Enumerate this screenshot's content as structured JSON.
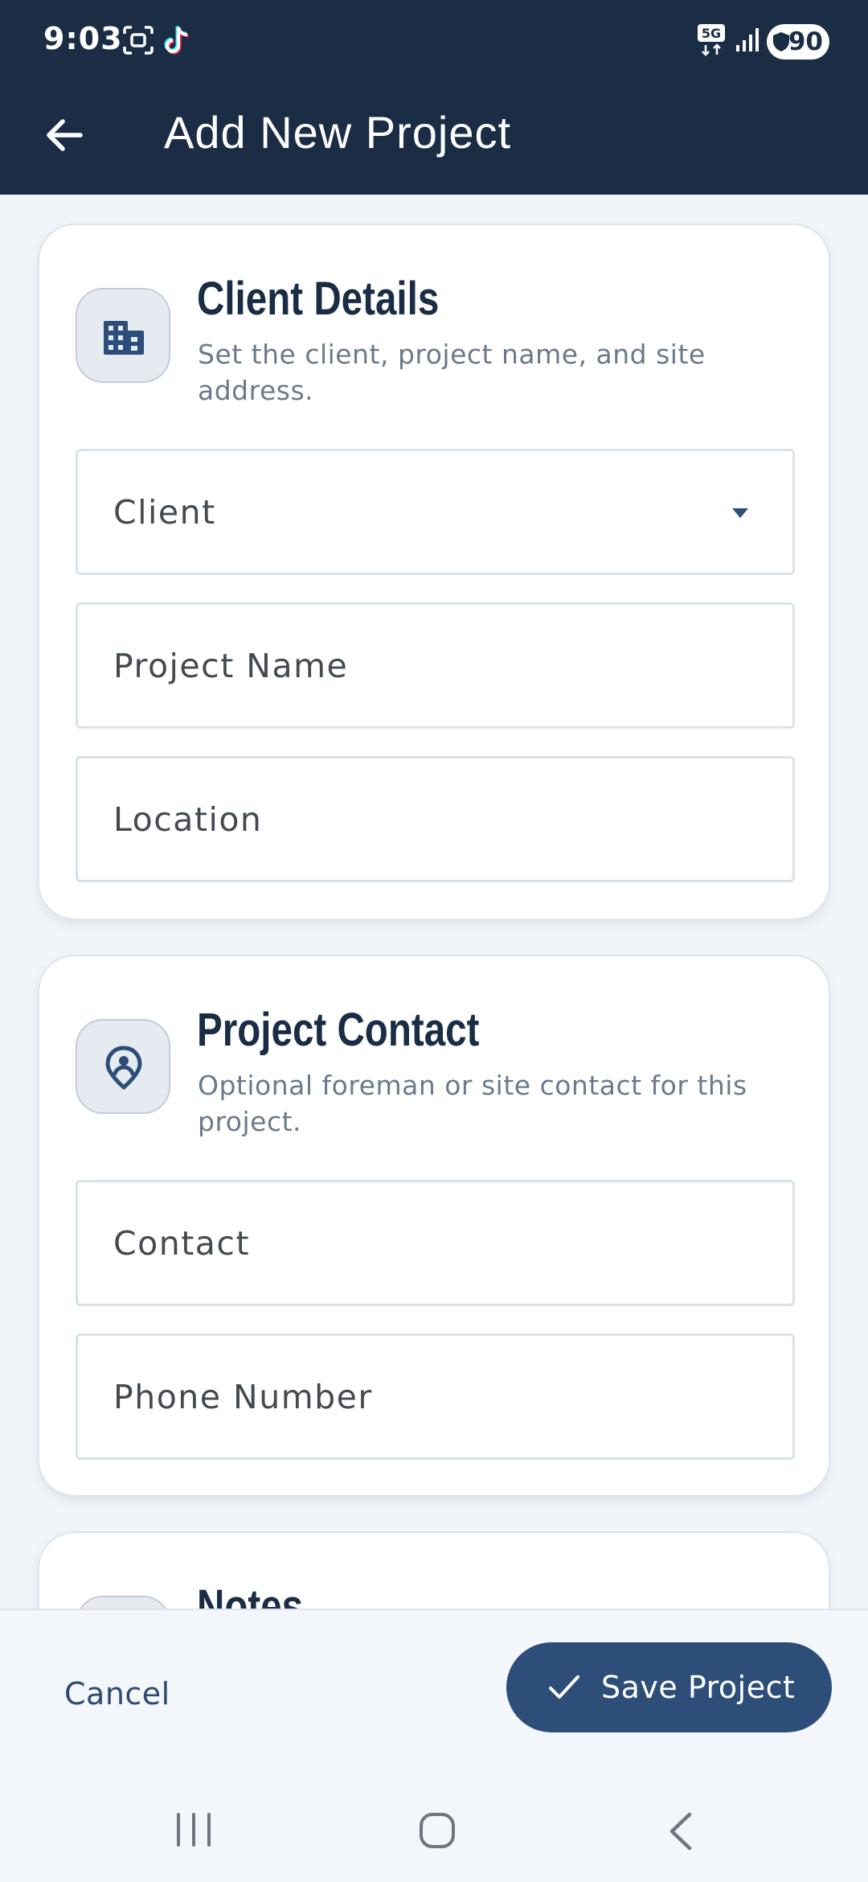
{
  "status": {
    "time": "9:03",
    "network": "5G",
    "battery": "90"
  },
  "appbar": {
    "title": "Add New Project"
  },
  "sections": {
    "client": {
      "title": "Client Details",
      "description": "Set the client, project name, and site address.",
      "fields": {
        "client": "Client",
        "project_name": "Project Name",
        "location": "Location"
      }
    },
    "contact": {
      "title": "Project Contact",
      "description": "Optional foreman or site contact for this project.",
      "fields": {
        "contact": "Contact",
        "phone": "Phone Number"
      }
    },
    "notes": {
      "title": "Notes"
    }
  },
  "actions": {
    "cancel": "Cancel",
    "save": "Save Project"
  },
  "icons": {
    "back": "back-arrow-icon",
    "client_section": "building-icon",
    "contact_section": "location-person-icon",
    "dropdown": "caret-down-icon",
    "save": "check-icon"
  },
  "colors": {
    "primary_dark": "#1a2d45",
    "accent": "#2c4e78",
    "background": "#f1f5fa"
  }
}
